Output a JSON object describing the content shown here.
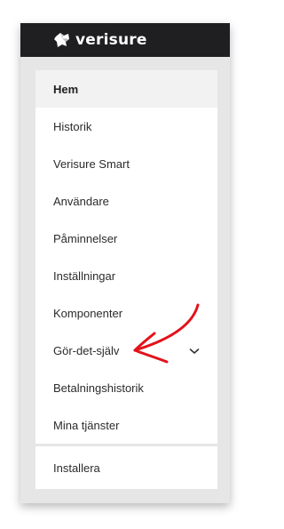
{
  "brand": {
    "logo_text": "verisure",
    "logo_icon": "verisure-shield-icon"
  },
  "menu": {
    "items": [
      {
        "label": "Hem",
        "active": true
      },
      {
        "label": "Historik"
      },
      {
        "label": "Verisure Smart"
      },
      {
        "label": "Användare"
      },
      {
        "label": "Påminnelser"
      },
      {
        "label": "Inställningar"
      },
      {
        "label": "Komponenter"
      },
      {
        "label": "Gör-det-själv",
        "expandable": true,
        "icon": "chevron-down-icon"
      },
      {
        "label": "Betalningshistorik"
      },
      {
        "label": "Mina tjänster"
      }
    ],
    "bottom_item": {
      "label": "Installera"
    }
  },
  "annotation": {
    "type": "hand-drawn-arrow",
    "color": "#e3111b",
    "points_to": "Gör-det-själv"
  },
  "colors": {
    "topbar": "#1f1f21",
    "panel_bg": "#e6e6e6",
    "active_item_bg": "#f2f2f2",
    "text": "#2b2b2b"
  }
}
